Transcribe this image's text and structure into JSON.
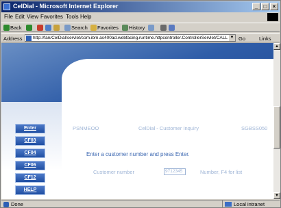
{
  "window": {
    "title": "CelDial - Microsoft Internet Explorer",
    "buttons": [
      "_",
      "□",
      "×"
    ]
  },
  "menu": [
    "File",
    "Edit",
    "View",
    "Favorites",
    "Tools",
    "Help"
  ],
  "toolbar": {
    "back": "Back",
    "search": "Search",
    "favorites": "Favorites",
    "history": "History"
  },
  "address": {
    "label": "Address",
    "url": "http://fan/CelDial/servlet/com.ibm.as400ad.webfacing.runtime.httpcontroller.ControllerServlet/CALL_ADTSLA",
    "go": "Go",
    "links": "Links"
  },
  "page": {
    "app_title": "CelDial",
    "program": "PSNMEOO",
    "screen_title": "CelDial - Customer Inquiry",
    "system": "SGBSS050",
    "prompt": "Enter a customer number and press Enter.",
    "field_label": "Customer number",
    "field_value": "9712345",
    "field_hint": "Number, F4 for list",
    "nav": [
      "Enter",
      "CF03",
      "CF04",
      "CF06",
      "CF12",
      "HELP"
    ]
  },
  "status": {
    "text": "Done",
    "zone": "Local intranet"
  },
  "colors": {
    "header_blue": "#2f5da8",
    "button_blue": "#1f4ea2",
    "muted_text": "#9fb5d6"
  }
}
